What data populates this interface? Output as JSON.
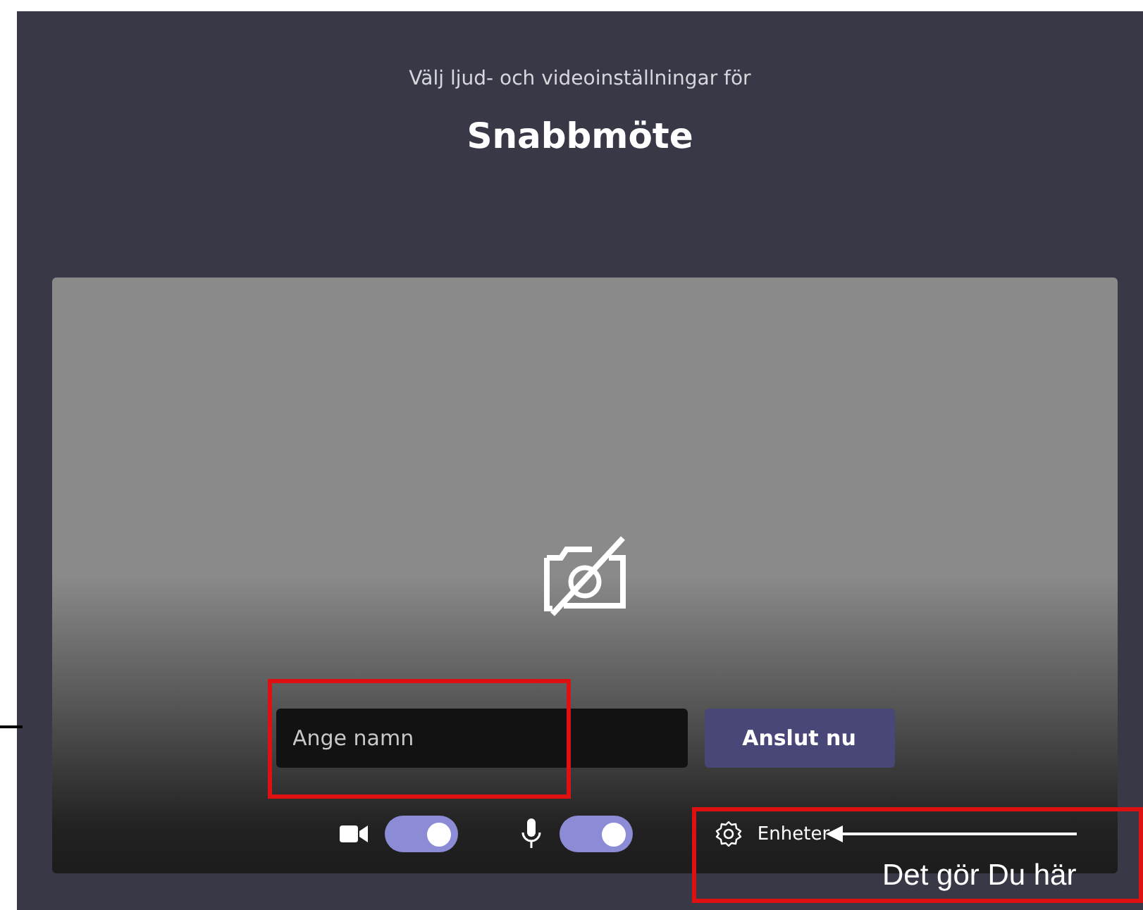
{
  "header": {
    "subtitle": "Välj ljud- och videoinställningar för",
    "title": "Snabbmöte"
  },
  "name_field": {
    "placeholder": "Ange namn"
  },
  "join_button": {
    "label": "Anslut nu"
  },
  "toggles": [
    {
      "kind": "camera",
      "on": true
    },
    {
      "kind": "mic",
      "on": true
    }
  ],
  "devices_button": {
    "label": "Enheter"
  },
  "annotation": {
    "label": "Det gör Du här"
  }
}
